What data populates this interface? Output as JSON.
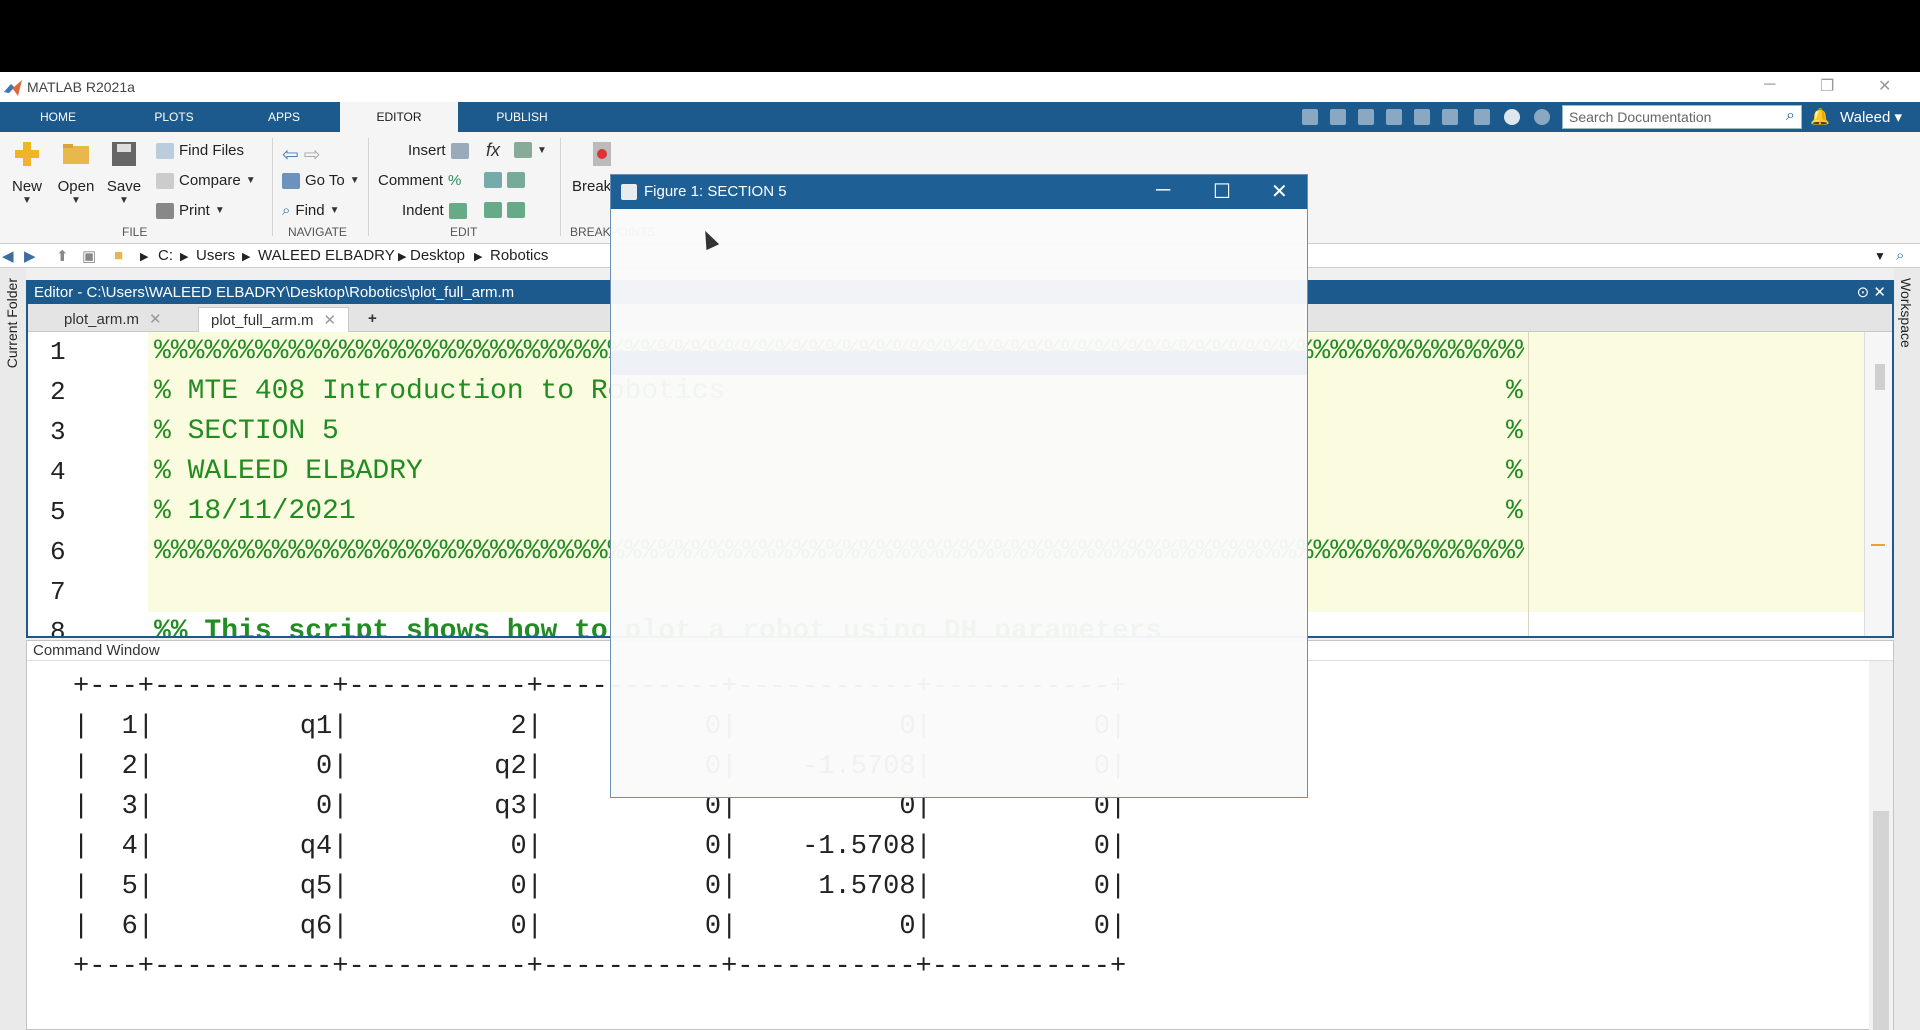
{
  "app": {
    "title": "MATLAB R2021a",
    "window_controls": [
      "─",
      "❐",
      "✕"
    ]
  },
  "tabs": [
    {
      "label": "HOME"
    },
    {
      "label": "PLOTS"
    },
    {
      "label": "APPS"
    },
    {
      "label": "EDITOR"
    },
    {
      "label": "PUBLISH"
    }
  ],
  "search": {
    "placeholder": "Search Documentation"
  },
  "user": {
    "name": "Waleed ▾"
  },
  "ribbon": {
    "file": {
      "new": "New",
      "open": "Open",
      "save": "Save",
      "find_files": "Find Files",
      "compare": "Compare",
      "print": "Print",
      "group": "FILE"
    },
    "navigate": {
      "go_to": "Go To",
      "find": "Find",
      "group": "NAVIGATE"
    },
    "edit": {
      "insert": "Insert",
      "comment": "Comment",
      "indent": "Indent",
      "fx": "fx",
      "pct": "%",
      "group": "EDIT"
    },
    "breakpoints": {
      "label": "Breakpoints",
      "group": "BREAKPOINTS"
    }
  },
  "address": {
    "crumbs": [
      "C:",
      "Users",
      "WALEED ELBADRY",
      "Desktop",
      "Robotics"
    ]
  },
  "sidebars": {
    "left": "Current Folder",
    "right": "Workspace"
  },
  "editor": {
    "header": "Editor - C:\\Users\\WALEED ELBADRY\\Desktop\\Robotics\\plot_full_arm.m",
    "tabs": [
      {
        "label": "plot_arm.m"
      },
      {
        "label": "plot_full_arm.m"
      }
    ],
    "add_tab": "+",
    "line_numbers": [
      "1",
      "2",
      "3",
      "4",
      "5",
      "6",
      "7",
      "8"
    ],
    "lines": [
      "%%%%%%%%%%%%%%%%%%%%%%%%%%%%%%%%%%%%%%%%%%%%%%%%%%%%%%%%%%%%%%%%%%%%%%%%%%%%%%%%%%%%%",
      "% MTE 408 Introduction to Robotics",
      "% SECTION 5",
      "% WALEED ELBADRY",
      "% 18/11/2021",
      "%%%%%%%%%%%%%%%%%%%%%%%%%%%%%%%%%%%%%%%%%%%%%%%%%%%%%%%%%%%%%%%%%%%%%%%%%%%%%%%%%%%%%",
      "",
      "%% This script shows how to plot a robot using DH parameters"
    ],
    "right_pct": "%"
  },
  "command_window": {
    "title": "Command Window",
    "rows": [
      "+---+-----------+-----------+-----------+-----------+-----------+",
      "|  1|         q1|          2|          0|          0|          0|",
      "|  2|          0|         q2|          0|    -1.5708|          0|",
      "|  3|          0|         q3|          0|          0|          0|",
      "|  4|         q4|          0|          0|    -1.5708|          0|",
      "|  5|         q5|          0|          0|     1.5708|          0|",
      "|  6|         q6|          0|          0|          0|          0|",
      "+---+-----------+-----------+-----------+-----------+-----------+"
    ]
  },
  "figure": {
    "title": "Figure 1: SECTION 5",
    "controls": [
      "─",
      "☐",
      "✕"
    ]
  }
}
